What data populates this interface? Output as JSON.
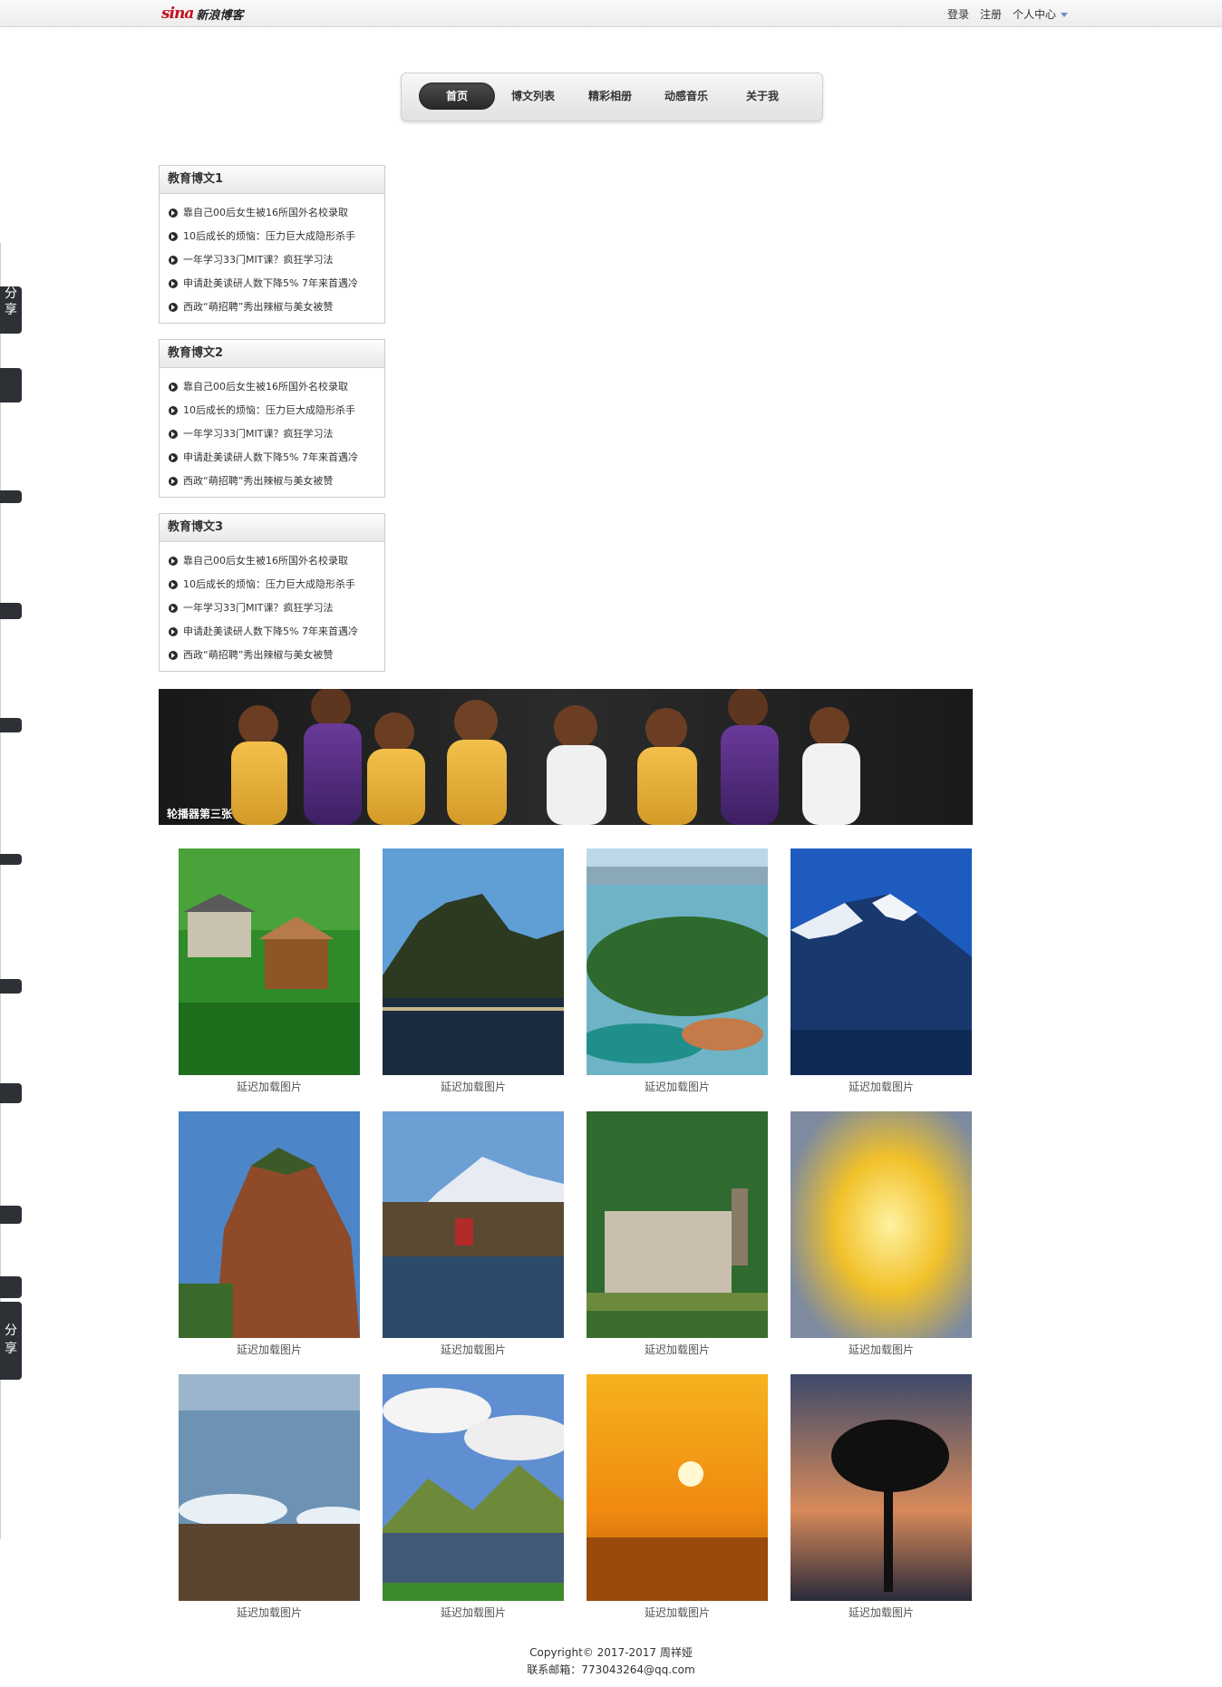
{
  "topbar": {
    "logo_mark": "sina",
    "logo_text": "新浪博客",
    "login": "登录",
    "register": "注册",
    "user_center": "个人中心"
  },
  "nav": [
    "首页",
    "博文列表",
    "精彩相册",
    "动感音乐",
    "关于我"
  ],
  "sidebar": {
    "share_label": "分享"
  },
  "boxes": [
    {
      "title": "教育博文1",
      "items": [
        "靠自己00后女生被16所国外名校录取",
        "10后成长的烦恼：压力巨大成隐形杀手",
        "一年学习33门MIT课？疯狂学习法",
        "申请赴美读研人数下降5% 7年来首遇冷",
        "西政“萌招聘”秀出辣椒与美女被赞"
      ]
    },
    {
      "title": "教育博文2",
      "items": [
        "靠自己00后女生被16所国外名校录取",
        "10后成长的烦恼：压力巨大成隐形杀手",
        "一年学习33门MIT课？疯狂学习法",
        "申请赴美读研人数下降5% 7年来首遇冷",
        "西政“萌招聘”秀出辣椒与美女被赞"
      ]
    },
    {
      "title": "教育博文3",
      "items": [
        "靠自己00后女生被16所国外名校录取",
        "10后成长的烦恼：压力巨大成隐形杀手",
        "一年学习33门MIT课？疯狂学习法",
        "申请赴美读研人数下降5% 7年来首遇冷",
        "西政“萌招聘”秀出辣椒与美女被赞"
      ]
    }
  ],
  "banner": {
    "caption": "轮播器第三张"
  },
  "gallery": {
    "captions": [
      "延迟加载图片",
      "延迟加载图片",
      "延迟加载图片",
      "延迟加载图片",
      "延迟加载图片",
      "延迟加载图片",
      "延迟加载图片",
      "延迟加载图片",
      "延迟加载图片",
      "延迟加载图片",
      "延迟加载图片",
      "延迟加载图片"
    ]
  },
  "footer": {
    "copyright": "Copyright© 2017-2017 周祥娅",
    "email": "联系邮箱：773043264@qq.com"
  }
}
